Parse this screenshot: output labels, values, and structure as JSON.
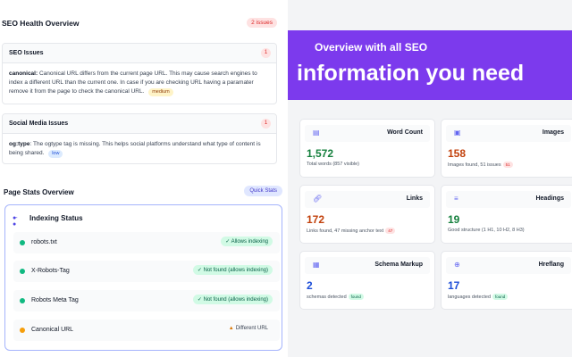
{
  "seo_overview": {
    "title": "SEO Health Overview",
    "issues_badge": "2 issues"
  },
  "seo_issues": {
    "title": "SEO Issues",
    "count": "1",
    "item": {
      "label": "canonical:",
      "text": "Canonical URL differs from the current page URL. This may cause search engines to index a different URL than the current one. In case if you are checking URL having a paramater remove it from the page to check the canonical URL.",
      "severity": "medium"
    }
  },
  "social_issues": {
    "title": "Social Media Issues",
    "count": "1",
    "item": {
      "label": "og:type",
      "text": ": The ogtype tag is missing. This helps social platforms understand what type of content is being shared.",
      "severity": "low"
    }
  },
  "page_stats": {
    "title": "Page Stats Overview",
    "quick_button": "Quick Stats"
  },
  "indexing": {
    "title": "Indexing Status",
    "rows": [
      {
        "name": "robots.txt",
        "status": "✓ Allows indexing",
        "state": "ok",
        "dot_color": "#10b981"
      },
      {
        "name": "X-Robots-Tag",
        "status": "✓ Not found (allows indexing)",
        "state": "ok",
        "dot_color": "#10b981"
      },
      {
        "name": "Robots Meta Tag",
        "status": "✓ Not found (allows indexing)",
        "state": "ok",
        "dot_color": "#10b981"
      },
      {
        "name": "Canonical URL",
        "status": "Different URL",
        "state": "warn",
        "dot_color": "#f59e0b"
      }
    ]
  },
  "banner": {
    "line1": "Overview with all SEO",
    "line2": "information you need"
  },
  "stats": [
    {
      "label": "Word Count",
      "icon": "document-icon",
      "value": "1,572",
      "sub": "Total words (857 visible)",
      "badge": "",
      "value_color": "green"
    },
    {
      "label": "Images",
      "icon": "image-icon",
      "value": "158",
      "sub": "Images found, 51 issues",
      "badge": "51",
      "value_color": "orange"
    },
    {
      "label": "Links",
      "icon": "link-icon",
      "value": "172",
      "sub": "Links found, 47 missing anchor text",
      "badge": "47",
      "value_color": "orange"
    },
    {
      "label": "Headings",
      "icon": "list-icon",
      "value": "19",
      "sub": "Good structure (1 H1, 10 H2, 8 H3)",
      "badge": "",
      "value_color": "green"
    },
    {
      "label": "Schema Markup",
      "icon": "grid-icon",
      "value": "2",
      "sub": "schemas detected",
      "badge": "found",
      "value_color": "blue"
    },
    {
      "label": "Hreflang",
      "icon": "globe-icon",
      "value": "17",
      "sub": "languages detected",
      "badge": "found",
      "value_color": "blue"
    }
  ],
  "colors": {
    "accent": "#7c3aed",
    "ok": "#10b981",
    "warn": "#f59e0b",
    "danger": "#dc2626"
  }
}
